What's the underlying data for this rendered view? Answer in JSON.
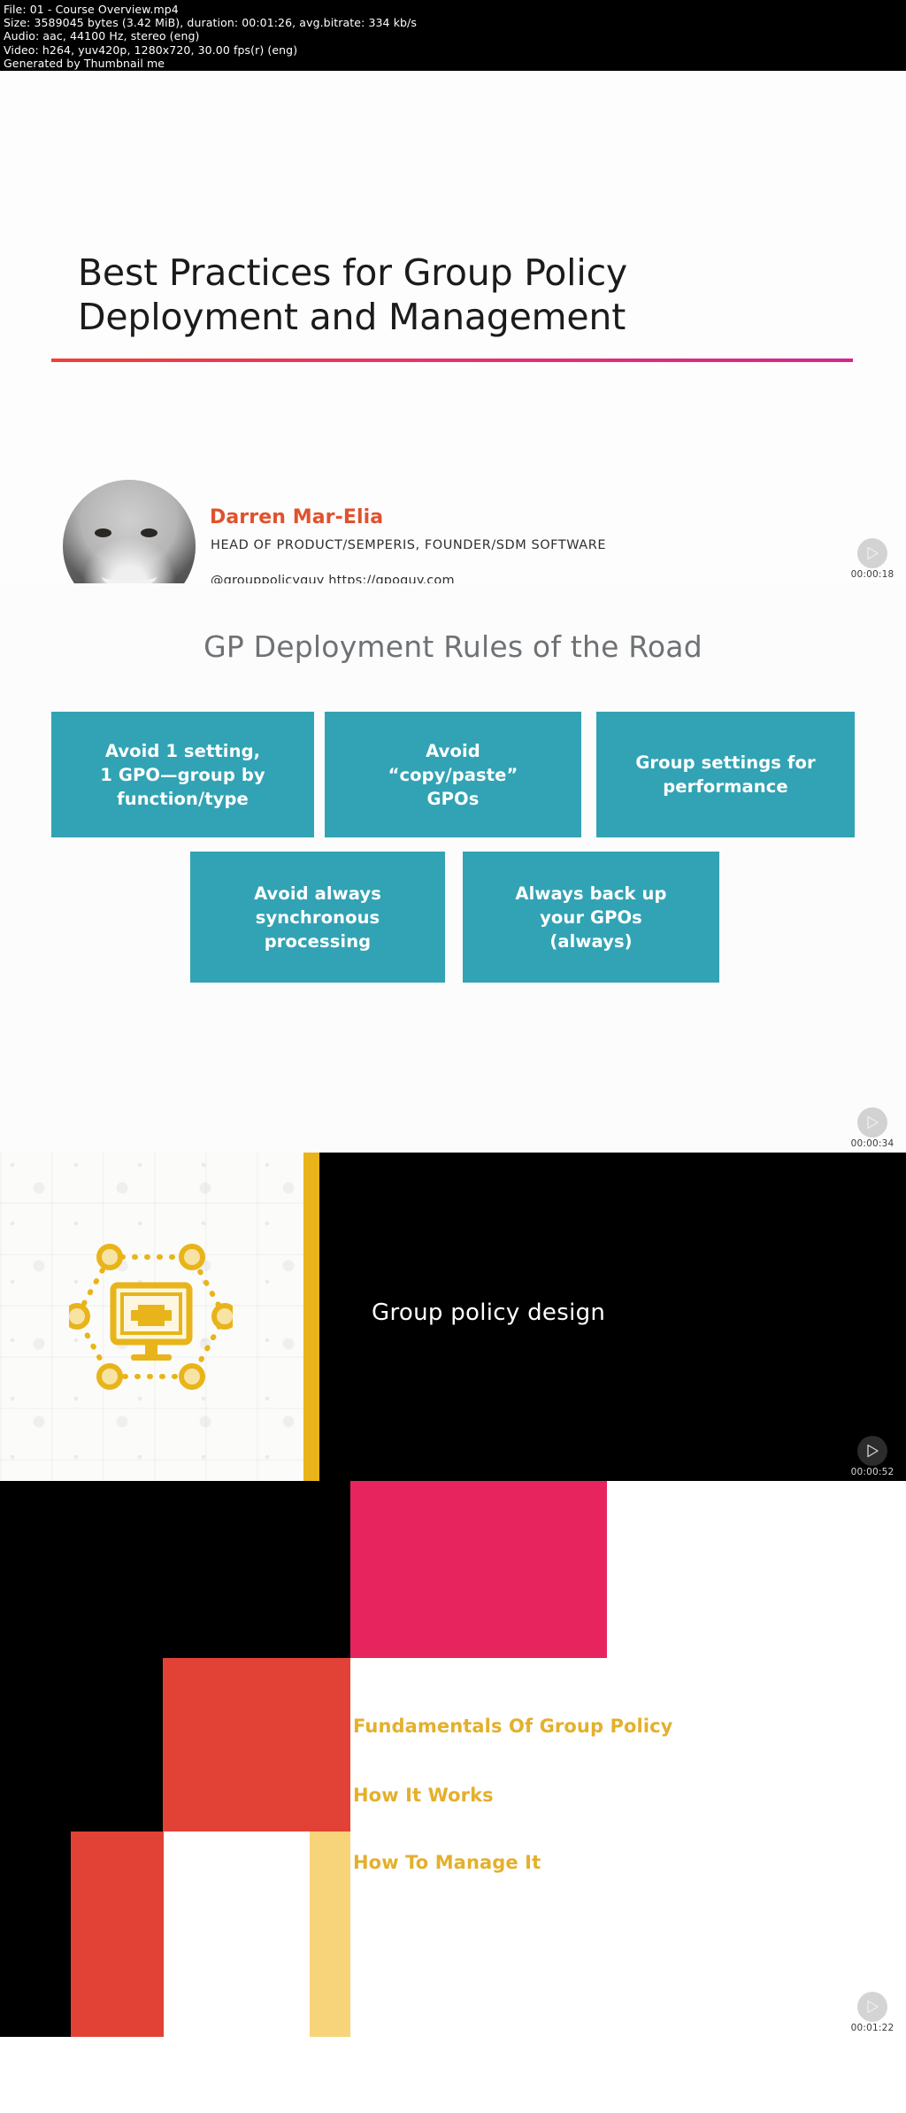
{
  "meta": {
    "lines": [
      "File: 01 - Course Overview.mp4",
      "Size: 3589045 bytes (3.42 MiB), duration: 00:01:26, avg.bitrate: 334 kb/s",
      "Audio: aac, 44100 Hz, stereo (eng)",
      "Video: h264, yuv420p, 1280x720, 30.00 fps(r) (eng)",
      "Generated by Thumbnail me"
    ]
  },
  "colors": {
    "teal": "#32a3b4",
    "orange": "#e0522f",
    "gold": "#e4b02c",
    "accent_bar": "#e8b419",
    "pink": "#e8245f",
    "red": "#e24236",
    "rule_start": "#ef4136",
    "rule_end": "#d6268e"
  },
  "frames": [
    {
      "index": 1,
      "timestamp": "00:00:18",
      "play_icon": "play-icon",
      "slide": {
        "kind": "title-slide",
        "title": "Best Practices for Group Policy Deployment and Management",
        "presenter": {
          "avatar": "presenter-photo",
          "name": "Darren Mar-Elia",
          "role": "HEAD OF PRODUCT/SEMPERIS, FOUNDER/SDM SOFTWARE",
          "links": "@grouppolicyguy  https://gpoguy.com"
        }
      }
    },
    {
      "index": 2,
      "timestamp": "00:00:34",
      "play_icon": "play-icon",
      "slide": {
        "kind": "rules-slide",
        "title": "GP Deployment Rules of the Road",
        "boxes": [
          "Avoid 1 setting,\n1 GPO—group by\nfunction/type",
          "Avoid\n“copy/paste”\nGPOs",
          "Group settings for\nperformance",
          "Avoid always\nsynchronous\nprocessing",
          "Always back up\nyour GPOs\n(always)"
        ]
      }
    },
    {
      "index": 3,
      "timestamp": "00:00:52",
      "play_icon": "play-icon",
      "slide": {
        "kind": "section-slide",
        "title": "Group policy design",
        "icon": "network-monitor-gear-icon"
      }
    },
    {
      "index": 4,
      "timestamp": "00:01:22",
      "play_icon": "play-icon",
      "slide": {
        "kind": "agenda-slide",
        "items": [
          "Fundamentals Of Group Policy",
          "How It Works",
          "How To Manage It"
        ]
      }
    }
  ]
}
